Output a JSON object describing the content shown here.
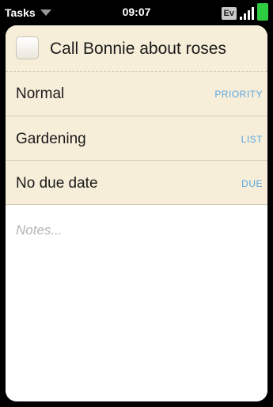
{
  "status_bar": {
    "app_name": "Tasks",
    "time": "09:07",
    "network": "Ev"
  },
  "task": {
    "title": "Call Bonnie about roses",
    "completed": false
  },
  "fields": [
    {
      "value": "Normal",
      "label": "PRIORITY"
    },
    {
      "value": "Gardening",
      "label": "LIST"
    },
    {
      "value": "No due date",
      "label": "DUE"
    }
  ],
  "notes": {
    "placeholder": "Notes..."
  },
  "colors": {
    "header_bg": "#f7eed9",
    "label_blue": "#5aa6e0",
    "battery_green": "#2ecc40"
  }
}
